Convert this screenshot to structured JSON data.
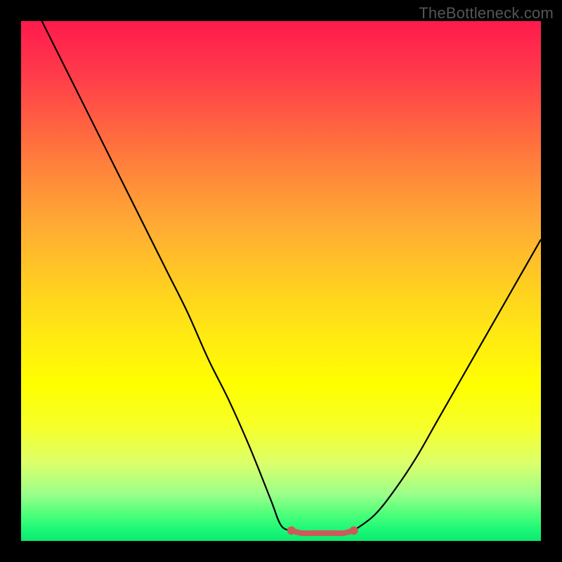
{
  "watermark": "TheBottleneck.com",
  "chart_data": {
    "type": "line",
    "title": "",
    "xlabel": "",
    "ylabel": "",
    "xlim": [
      0,
      100
    ],
    "ylim": [
      0,
      100
    ],
    "series": [
      {
        "name": "curve-left",
        "x": [
          4,
          8,
          12,
          16,
          20,
          24,
          28,
          32,
          36,
          40,
          44,
          48,
          50,
          52
        ],
        "values": [
          100,
          92,
          84,
          76,
          68,
          60,
          52,
          44,
          35,
          27,
          18,
          8,
          3,
          2
        ]
      },
      {
        "name": "valley-floor",
        "x": [
          52,
          54,
          56,
          58,
          60,
          62,
          64
        ],
        "values": [
          2,
          1.5,
          1.5,
          1.5,
          1.5,
          1.5,
          2
        ]
      },
      {
        "name": "curve-right",
        "x": [
          64,
          68,
          72,
          76,
          80,
          84,
          88,
          92,
          96,
          100
        ],
        "values": [
          2,
          5,
          10,
          16,
          23,
          30,
          37,
          44,
          51,
          58
        ]
      }
    ],
    "annotations": [
      {
        "name": "watermark",
        "text": "TheBottleneck.com",
        "position": "top-right"
      }
    ],
    "colors": {
      "gradient_top": "#ff1a4d",
      "gradient_mid": "#ffe814",
      "gradient_bottom": "#0de96e",
      "curve": "#000000",
      "valley_marker": "#cc5a5a",
      "background": "#000000"
    }
  }
}
